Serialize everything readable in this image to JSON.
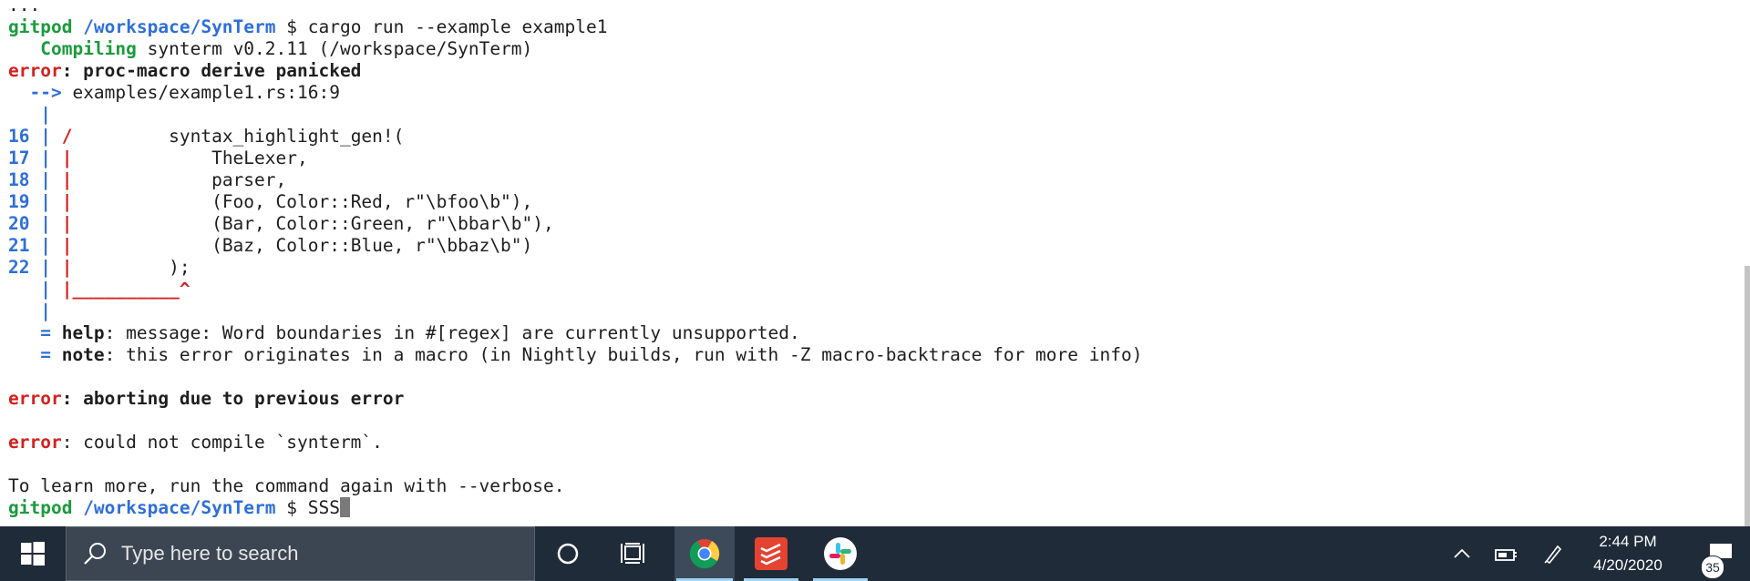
{
  "terminal": {
    "lines": [
      {
        "segs": [
          {
            "t": "...",
            "c": ""
          }
        ]
      },
      {
        "segs": [
          {
            "t": "gitpod ",
            "c": "green"
          },
          {
            "t": "/workspace/SynTerm",
            "c": "blue"
          },
          {
            "t": " $ cargo run --example example1",
            "c": ""
          }
        ]
      },
      {
        "segs": [
          {
            "t": "   ",
            "c": ""
          },
          {
            "t": "Compiling",
            "c": "green"
          },
          {
            "t": " synterm v0.2.11 (/workspace/SynTerm)",
            "c": ""
          }
        ]
      },
      {
        "segs": [
          {
            "t": "error",
            "c": "red"
          },
          {
            "t": ": proc-macro derive panicked",
            "c": "bold"
          }
        ]
      },
      {
        "segs": [
          {
            "t": "  --> ",
            "c": "blue"
          },
          {
            "t": "examples/example1.rs:16:9",
            "c": ""
          }
        ]
      },
      {
        "segs": [
          {
            "t": "   |",
            "c": "blue"
          }
        ]
      },
      {
        "segs": [
          {
            "t": "16 | ",
            "c": "blue"
          },
          {
            "t": "/",
            "c": "red"
          },
          {
            "t": "         syntax_highlight_gen!(",
            "c": ""
          }
        ]
      },
      {
        "segs": [
          {
            "t": "17 | ",
            "c": "blue"
          },
          {
            "t": "|",
            "c": "red"
          },
          {
            "t": "             TheLexer,",
            "c": ""
          }
        ]
      },
      {
        "segs": [
          {
            "t": "18 | ",
            "c": "blue"
          },
          {
            "t": "|",
            "c": "red"
          },
          {
            "t": "             parser,",
            "c": ""
          }
        ]
      },
      {
        "segs": [
          {
            "t": "19 | ",
            "c": "blue"
          },
          {
            "t": "|",
            "c": "red"
          },
          {
            "t": "             (Foo, Color::Red, r\"\\bfoo\\b\"),",
            "c": ""
          }
        ]
      },
      {
        "segs": [
          {
            "t": "20 | ",
            "c": "blue"
          },
          {
            "t": "|",
            "c": "red"
          },
          {
            "t": "             (Bar, Color::Green, r\"\\bbar\\b\"),",
            "c": ""
          }
        ]
      },
      {
        "segs": [
          {
            "t": "21 | ",
            "c": "blue"
          },
          {
            "t": "|",
            "c": "red"
          },
          {
            "t": "             (Baz, Color::Blue, r\"\\bbaz\\b\")",
            "c": ""
          }
        ]
      },
      {
        "segs": [
          {
            "t": "22 | ",
            "c": "blue"
          },
          {
            "t": "|",
            "c": "red"
          },
          {
            "t": "         );",
            "c": ""
          }
        ]
      },
      {
        "segs": [
          {
            "t": "   | ",
            "c": "blue"
          },
          {
            "t": "|__________^",
            "c": "red"
          }
        ]
      },
      {
        "segs": [
          {
            "t": "   |",
            "c": "blue"
          }
        ]
      },
      {
        "segs": [
          {
            "t": "   = ",
            "c": "blue"
          },
          {
            "t": "help",
            "c": "bold"
          },
          {
            "t": ": message: Word boundaries in #[regex] are currently unsupported.",
            "c": ""
          }
        ]
      },
      {
        "segs": [
          {
            "t": "   = ",
            "c": "blue"
          },
          {
            "t": "note",
            "c": "bold"
          },
          {
            "t": ": this error originates in a macro (in Nightly builds, run with -Z macro-backtrace for more info)",
            "c": ""
          }
        ]
      },
      {
        "segs": [
          {
            "t": " ",
            "c": ""
          }
        ]
      },
      {
        "segs": [
          {
            "t": "error",
            "c": "red"
          },
          {
            "t": ": aborting due to previous error",
            "c": "bold"
          }
        ]
      },
      {
        "segs": [
          {
            "t": " ",
            "c": ""
          }
        ]
      },
      {
        "segs": [
          {
            "t": "error",
            "c": "red"
          },
          {
            "t": ": could not compile `synterm`.",
            "c": ""
          }
        ]
      },
      {
        "segs": [
          {
            "t": " ",
            "c": ""
          }
        ]
      },
      {
        "segs": [
          {
            "t": "To learn more, run the command again with --verbose.",
            "c": ""
          }
        ]
      },
      {
        "segs": [
          {
            "t": "gitpod ",
            "c": "green"
          },
          {
            "t": "/workspace/SynTerm",
            "c": "blue"
          },
          {
            "t": " $ SSS",
            "c": ""
          }
        ],
        "cursor": true
      }
    ]
  },
  "taskbar": {
    "search_placeholder": "Type here to search",
    "clock_time": "2:44 PM",
    "clock_date": "4/20/2020",
    "notification_count": "35",
    "apps": [
      "chrome-icon",
      "todoist-icon",
      "slack-icon"
    ]
  },
  "colors": {
    "green": "#1a9b3c",
    "blue": "#2f6fd8",
    "red": "#d4201c",
    "taskbar": "#1f2b38"
  }
}
